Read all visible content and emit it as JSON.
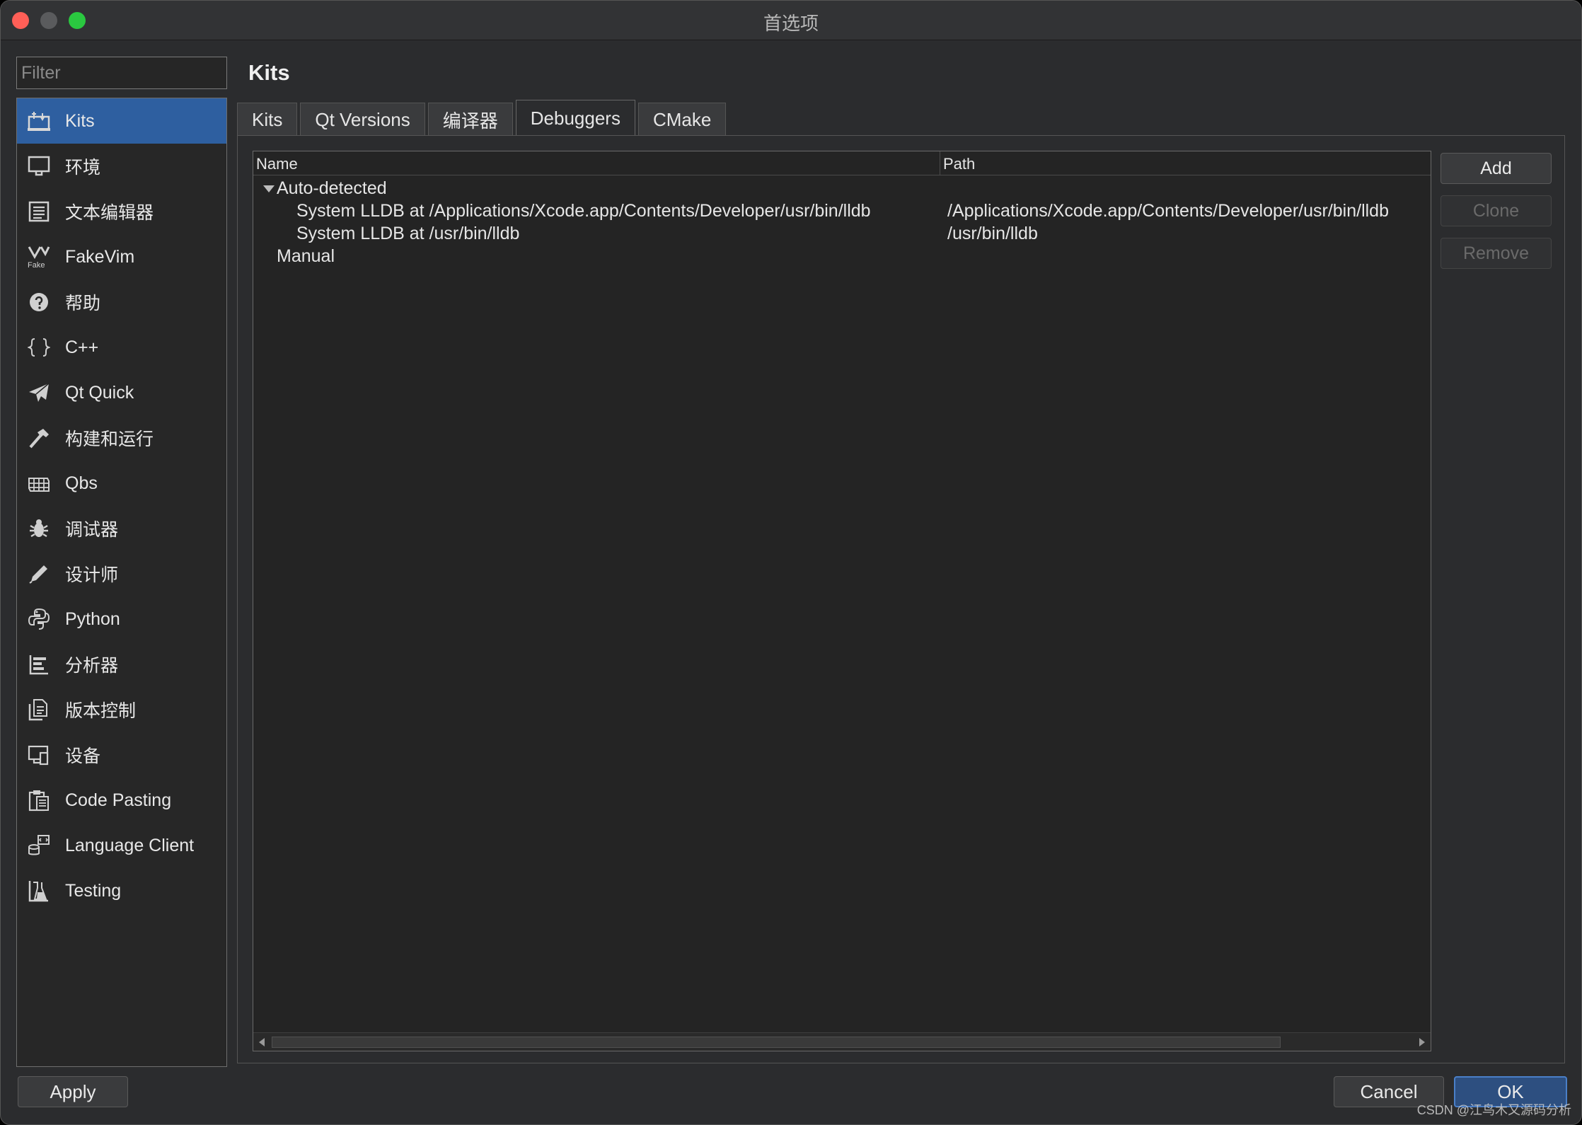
{
  "window": {
    "title": "首选项"
  },
  "filter": {
    "placeholder": "Filter"
  },
  "sidebar": {
    "items": [
      {
        "label": "Kits",
        "icon": "kits-icon",
        "selected": true
      },
      {
        "label": "环境",
        "icon": "monitor-icon"
      },
      {
        "label": "文本编辑器",
        "icon": "text-editor-icon"
      },
      {
        "label": "FakeVim",
        "icon": "fakevim-icon",
        "icon_text": "Fake"
      },
      {
        "label": "帮助",
        "icon": "help-icon"
      },
      {
        "label": "C++",
        "icon": "braces-icon"
      },
      {
        "label": "Qt Quick",
        "icon": "paper-plane-icon"
      },
      {
        "label": "构建和运行",
        "icon": "hammer-icon"
      },
      {
        "label": "Qbs",
        "icon": "qbs-grid-icon"
      },
      {
        "label": "调试器",
        "icon": "bug-icon"
      },
      {
        "label": "设计师",
        "icon": "pencil-icon"
      },
      {
        "label": "Python",
        "icon": "python-icon"
      },
      {
        "label": "分析器",
        "icon": "analyzer-icon"
      },
      {
        "label": "版本控制",
        "icon": "version-control-icon"
      },
      {
        "label": "设备",
        "icon": "devices-icon"
      },
      {
        "label": "Code Pasting",
        "icon": "clipboard-icon"
      },
      {
        "label": "Language Client",
        "icon": "language-client-icon"
      },
      {
        "label": "Testing",
        "icon": "flask-icon"
      }
    ]
  },
  "main": {
    "title": "Kits",
    "tabs": [
      {
        "label": "Kits"
      },
      {
        "label": "Qt Versions"
      },
      {
        "label": "编译器"
      },
      {
        "label": "Debuggers",
        "active": true
      },
      {
        "label": "CMake"
      }
    ],
    "tree": {
      "columns": {
        "name": "Name",
        "path": "Path"
      },
      "groups": [
        {
          "label": "Auto-detected",
          "expanded": true,
          "rows": [
            {
              "name": "System LLDB at /Applications/Xcode.app/Contents/Developer/usr/bin/lldb",
              "path": "/Applications/Xcode.app/Contents/Developer/usr/bin/lldb"
            },
            {
              "name": "System LLDB at /usr/bin/lldb",
              "path": "/usr/bin/lldb"
            }
          ]
        },
        {
          "label": "Manual",
          "expanded": false,
          "rows": []
        }
      ]
    },
    "buttons": {
      "add": "Add",
      "clone": "Clone",
      "remove": "Remove"
    }
  },
  "footer": {
    "apply": "Apply",
    "cancel": "Cancel",
    "ok": "OK"
  },
  "watermark": "CSDN @江鸟木又源码分析",
  "colors": {
    "selection": "#2e5fa0",
    "background": "#2b2c2e",
    "close": "#ff5f57",
    "maximize": "#2ac840"
  }
}
